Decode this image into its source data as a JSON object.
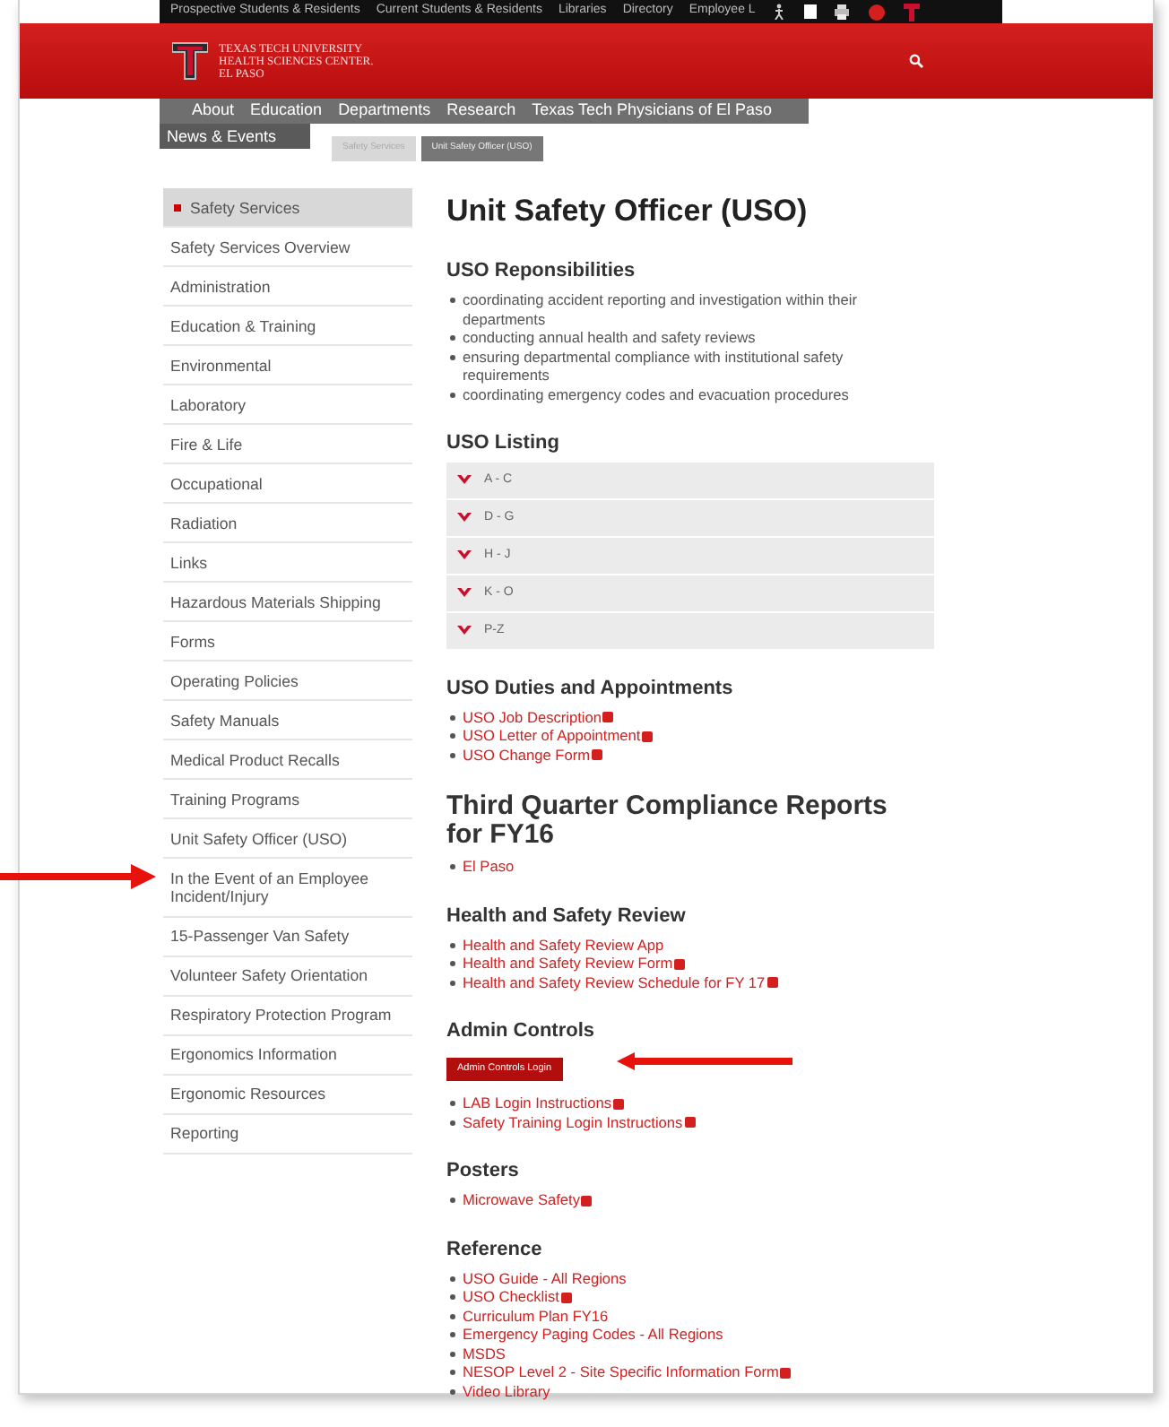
{
  "top_links": [
    "Prospective Students & Residents",
    "Current Students & Residents",
    "Libraries",
    "Directory",
    "Employee L"
  ],
  "header": {
    "logo_lines": [
      "TEXAS TECH UNIVERSITY",
      "HEALTH SCIENCES CENTER.",
      "EL PASO"
    ]
  },
  "nav": [
    "About",
    "Education",
    "Departments",
    "Research",
    "Texas Tech Physicians of El Paso"
  ],
  "nav_overflow": "News & Events",
  "breadcrumb": [
    {
      "label": "Safety Services",
      "selected": false
    },
    {
      "label": "Unit Safety Officer (USO)",
      "selected": true
    }
  ],
  "sidebar": {
    "items": [
      {
        "label": "Safety Services",
        "selected": true,
        "arrow": false
      },
      {
        "label": "Safety Services Overview",
        "selected": false,
        "arrow": false
      },
      {
        "label": "Administration",
        "selected": false,
        "arrow": false
      },
      {
        "label": "Education & Training",
        "selected": false,
        "arrow": false
      },
      {
        "label": "Environmental",
        "selected": false,
        "arrow": false
      },
      {
        "label": "Laboratory",
        "selected": false,
        "arrow": false
      },
      {
        "label": "Fire & Life",
        "selected": false,
        "arrow": false
      },
      {
        "label": "Occupational",
        "selected": false,
        "arrow": false
      },
      {
        "label": "Radiation",
        "selected": false,
        "arrow": false
      },
      {
        "label": "Links",
        "selected": false,
        "arrow": false
      },
      {
        "label": "Hazardous Materials Shipping",
        "selected": false,
        "arrow": false
      },
      {
        "label": "Forms",
        "selected": false,
        "arrow": false
      },
      {
        "label": "Operating Policies",
        "selected": false,
        "arrow": false
      },
      {
        "label": "Safety Manuals",
        "selected": false,
        "arrow": false
      },
      {
        "label": "Medical Product Recalls",
        "selected": false,
        "arrow": false
      },
      {
        "label": "Training Programs",
        "selected": false,
        "arrow": false
      },
      {
        "label": "Unit Safety Officer (USO)",
        "selected": false,
        "arrow": false
      },
      {
        "label": "In the Event of an Employee Incident/Injury",
        "selected": false,
        "arrow": true
      },
      {
        "label": "15-Passenger Van Safety",
        "selected": false,
        "arrow": false
      },
      {
        "label": "Volunteer Safety Orientation",
        "selected": false,
        "arrow": false
      },
      {
        "label": "Respiratory Protection Program",
        "selected": false,
        "arrow": false
      },
      {
        "label": "Ergonomics Information",
        "selected": false,
        "arrow": false
      },
      {
        "label": "Ergonomic Resources",
        "selected": false,
        "arrow": false
      },
      {
        "label": "Reporting",
        "selected": false,
        "arrow": false
      }
    ]
  },
  "page_title": "Unit Safety Officer (USO)",
  "sections": [
    {
      "heading": "USO Reponsibilities",
      "large_heading": false,
      "kind": "bullets",
      "items": [
        {
          "text": "coordinating accident reporting and investigation within their departments"
        },
        {
          "text": "conducting annual health and safety reviews"
        },
        {
          "text": "ensuring departmental compliance with institutional safety requirements"
        },
        {
          "text": "coordinating emergency codes and evacuation procedures"
        }
      ]
    },
    {
      "heading": "USO Listing",
      "large_heading": false,
      "kind": "accordion",
      "items": [
        {
          "text": "A - C",
          "expanded": false
        },
        {
          "text": "D - G",
          "expanded": false
        },
        {
          "text": "H - J",
          "expanded": false
        },
        {
          "text": "K - O",
          "expanded": false
        },
        {
          "text": "P-Z",
          "expanded": false
        }
      ]
    },
    {
      "heading": "USO Duties and Appointments",
      "large_heading": false,
      "kind": "links",
      "items": [
        {
          "text": "USO Job Description",
          "pdf": true
        },
        {
          "text": "USO Letter of Appointment",
          "pdf": true
        },
        {
          "text": "USO Change Form",
          "pdf": true
        }
      ]
    },
    {
      "heading": "Third Quarter Compliance Reports for FY16",
      "large_heading": true,
      "kind": "links",
      "items": [
        {
          "text": "El Paso",
          "pdf": false
        }
      ]
    },
    {
      "heading": "Health and Safety Review",
      "large_heading": false,
      "kind": "links",
      "items": [
        {
          "text": "Health and Safety Review App",
          "pdf": false
        },
        {
          "text": "Health and Safety Review Form",
          "pdf": true
        },
        {
          "text": "Health and Safety Review Schedule for FY 17",
          "pdf": true
        }
      ]
    },
    {
      "heading": "Admin Controls",
      "large_heading": false,
      "kind": "links",
      "button": {
        "label": "Admin Controls Login",
        "arrow": true
      },
      "items": [
        {
          "text": "LAB Login Instructions",
          "pdf": true
        },
        {
          "text": "Safety Training Login Instructions",
          "pdf": true
        }
      ]
    },
    {
      "heading": "Posters",
      "large_heading": false,
      "kind": "links",
      "items": [
        {
          "text": "Microwave Safety",
          "pdf": true
        }
      ]
    },
    {
      "heading": "Reference",
      "large_heading": false,
      "kind": "links",
      "items": [
        {
          "text": "USO Guide - All Regions",
          "pdf": false
        },
        {
          "text": "USO Checklist",
          "pdf": true
        },
        {
          "text": "Curriculum Plan FY16",
          "pdf": false
        },
        {
          "text": "Emergency Paging Codes - All Regions",
          "pdf": false
        },
        {
          "text": "MSDS",
          "pdf": false
        },
        {
          "text": "NESOP Level 2 - Site Specific Information Form",
          "pdf": true
        },
        {
          "text": "Video Library",
          "pdf": false
        }
      ]
    }
  ]
}
